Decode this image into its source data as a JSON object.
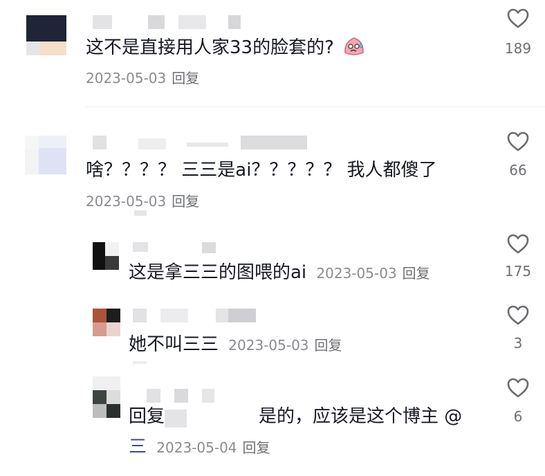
{
  "comments": [
    {
      "text": "这不是直接用人家33的脸套的?",
      "date": "2023-05-03",
      "reply": "回复",
      "likes": "189"
    },
    {
      "text": "啥？？？？ 三三是ai？？？？？ 我人都傻了",
      "date": "2023-05-03",
      "reply": "回复",
      "likes": "66"
    }
  ],
  "replies": [
    {
      "text": "这是拿三三的图喂的ai",
      "date": "2023-05-03",
      "reply": "回复",
      "likes": "175"
    },
    {
      "text": "她不叫三三",
      "date": "2023-05-03",
      "reply": "回复",
      "likes": "3"
    },
    {
      "text_a": "回复",
      "text_b": "是的，应该是这个博主 @",
      "mention_end": "三",
      "date": "2023-05-04",
      "reply": "回复",
      "likes": "6"
    }
  ],
  "icons": {
    "heart": "heart-outline-icon",
    "emoji": "sweating-face-emoji-icon"
  },
  "colors": {
    "text": "#161823",
    "meta": "#8a8b91",
    "heart_stroke": "#6b6b70",
    "mention": "#3e4a8c"
  }
}
